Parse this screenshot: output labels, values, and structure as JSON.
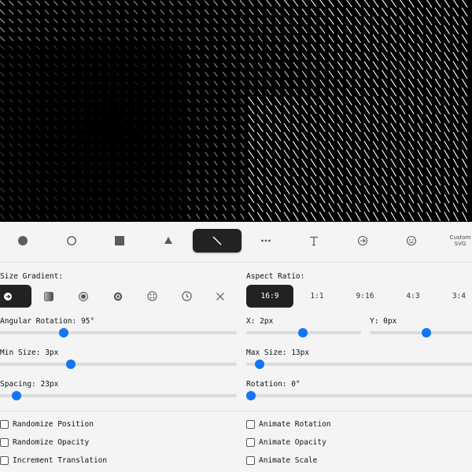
{
  "shapes": [
    {
      "name": "circle-filled",
      "icon": "filled-circle-icon",
      "active": false
    },
    {
      "name": "circle-outline",
      "icon": "outline-circle-icon",
      "active": false
    },
    {
      "name": "square",
      "icon": "filled-square-icon",
      "active": false
    },
    {
      "name": "triangle",
      "icon": "filled-triangle-icon",
      "active": false
    },
    {
      "name": "line",
      "icon": "diagonal-line-icon",
      "active": true
    },
    {
      "name": "dots",
      "icon": "ellipsis-icon",
      "active": false
    },
    {
      "name": "text",
      "icon": "text-t-icon",
      "active": false
    },
    {
      "name": "arrow",
      "icon": "arrow-circle-icon",
      "active": false
    },
    {
      "name": "emoji",
      "icon": "smiley-icon",
      "active": false
    },
    {
      "name": "custom-svg",
      "label": "Custom\nSVG",
      "active": false
    }
  ],
  "size_gradient": {
    "label": "Size Gradient:",
    "options": [
      {
        "icon": "radial-arrow-icon",
        "active": true
      },
      {
        "icon": "linear-gradient-square-icon",
        "active": false
      },
      {
        "icon": "center-dot-square-icon",
        "active": false
      },
      {
        "icon": "ring-dot-icon",
        "active": false
      },
      {
        "icon": "scatter-dots-icon",
        "active": false
      },
      {
        "icon": "clock-icon",
        "active": false
      },
      {
        "icon": "close-x-icon",
        "active": false
      }
    ]
  },
  "aspect_ratio": {
    "label": "Aspect Ratio:",
    "options": [
      {
        "label": "16:9",
        "active": true
      },
      {
        "label": "1:1",
        "active": false
      },
      {
        "label": "9:16",
        "active": false
      },
      {
        "label": "4:3",
        "active": false
      },
      {
        "label": "3:4",
        "active": false
      }
    ]
  },
  "controls": {
    "angular_rotation": {
      "label": "Angular Rotation: 95°",
      "value": 95,
      "fraction": 0.27
    },
    "x": {
      "label": "X: 2px",
      "value": 2,
      "fraction": 0.49
    },
    "y": {
      "label": "Y: 0px",
      "value": 0,
      "fraction": 0.55
    },
    "min_size": {
      "label": "Min Size: 3px",
      "value": 3,
      "fraction": 0.3
    },
    "max_size": {
      "label": "Max Size: 13px",
      "value": 13,
      "fraction": 0.06
    },
    "spacing": {
      "label": "Spacing: 23px",
      "value": 23,
      "fraction": 0.07
    },
    "rotation": {
      "label": "Rotation: 0°",
      "value": 0,
      "fraction": 0.0
    }
  },
  "checkboxes": {
    "randomize_position": {
      "label": "Randomize Position",
      "checked": false
    },
    "randomize_opacity": {
      "label": "Randomize Opacity",
      "checked": false
    },
    "increment_translation": {
      "label": "Increment Translation",
      "checked": false
    },
    "animate_rotation": {
      "label": "Animate Rotation",
      "checked": false
    },
    "animate_opacity": {
      "label": "Animate Opacity",
      "checked": false
    },
    "animate_scale": {
      "label": "Animate Scale",
      "checked": false
    }
  },
  "colors": {
    "accent": "#1476f2",
    "active_bg": "#222222",
    "canvas_bg": "#000000",
    "stroke": "#ffffff"
  }
}
